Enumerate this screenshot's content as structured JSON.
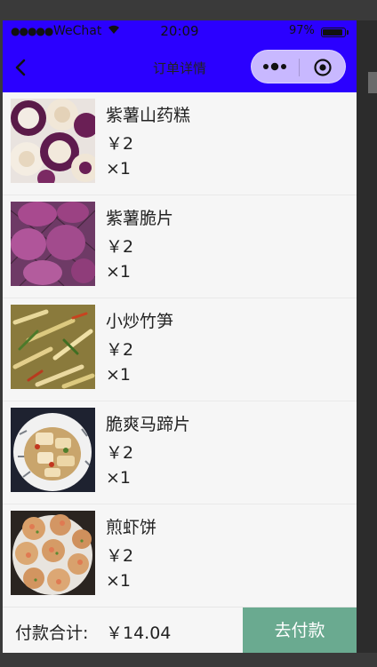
{
  "status_bar": {
    "signal": "●●●●●",
    "carrier": "WeChat",
    "time": "20:09",
    "battery": "97%",
    "battery_fraction": 0.97
  },
  "nav": {
    "title": "订单详情"
  },
  "order": {
    "items": [
      {
        "name": "紫薯山药糕",
        "price": "￥2",
        "quantity": "×1",
        "image": "purple-yam-cake-photo"
      },
      {
        "name": "紫薯脆片",
        "price": "￥2",
        "quantity": "×1",
        "image": "purple-sweet-potato-chips-photo"
      },
      {
        "name": "小炒竹笋",
        "price": "￥2",
        "quantity": "×1",
        "image": "stir-fried-bamboo-shoots-photo"
      },
      {
        "name": "脆爽马蹄片",
        "price": "￥2",
        "quantity": "×1",
        "image": "crispy-water-chestnut-slices-photo"
      },
      {
        "name": "煎虾饼",
        "price": "￥2",
        "quantity": "×1",
        "image": "fried-shrimp-cakes-photo"
      }
    ]
  },
  "footer": {
    "total_label": "付款合计:",
    "total_value": "￥14.04",
    "pay_button": "去付款"
  },
  "colors": {
    "nav_background": "#2b00ff",
    "capsule_background": "#c8b8ff",
    "pay_button": "#6aaa90",
    "page_background": "#f6f6f6"
  }
}
